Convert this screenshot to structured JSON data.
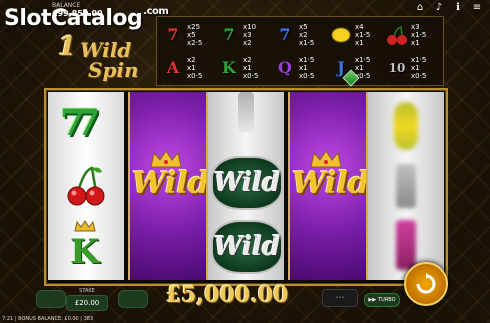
{
  "watermark": {
    "slot": "Slot",
    "catalog": "Catalog",
    "com": ".com"
  },
  "balance": {
    "label": "BALANCE",
    "value": "£99,850.00"
  },
  "logo": {
    "one": "1",
    "wild": "Wild",
    "spin": "Spin"
  },
  "paytable": [
    {
      "symbol": "seven",
      "glyph": "7",
      "color": "#e03030",
      "pays": [
        "x25",
        "x5",
        "x2·5"
      ]
    },
    {
      "symbol": "green-seven",
      "glyph": "7",
      "color": "#2ea33a",
      "pays": [
        "x10",
        "x3",
        "x2"
      ]
    },
    {
      "symbol": "blue-seven",
      "glyph": "7",
      "color": "#3a78e8",
      "pays": [
        "x5",
        "x2",
        "x1·5"
      ]
    },
    {
      "symbol": "lemon",
      "glyph": "",
      "color": "#f4d020",
      "pays": [
        "x4",
        "x1·5",
        "x1"
      ]
    },
    {
      "symbol": "cherries",
      "glyph": "",
      "color": "#d02020",
      "pays": [
        "x3",
        "x1·5",
        "x1"
      ]
    },
    {
      "symbol": "A",
      "glyph": "A",
      "color": "#e03030",
      "pays": [
        "x2",
        "x1",
        "x0·5"
      ]
    },
    {
      "symbol": "K",
      "glyph": "K",
      "color": "#2ea33a",
      "pays": [
        "x2",
        "x1",
        "x0·5"
      ]
    },
    {
      "symbol": "Q",
      "glyph": "Q",
      "color": "#9a40d8",
      "pays": [
        "x1·5",
        "x1",
        "x0·5"
      ]
    },
    {
      "symbol": "J",
      "glyph": "J",
      "color": "#3a78e8",
      "pays": [
        "x1·5",
        "x1",
        "x0·5"
      ]
    },
    {
      "symbol": "10",
      "glyph": "10",
      "color": "#c0c0c0",
      "pays": [
        "x1·5",
        "x1",
        "x0·5"
      ]
    }
  ],
  "reels": {
    "wild_label": "Wild",
    "wild_label_2": "Wild",
    "wild_green_1": "Wild",
    "wild_green_2": "Wild",
    "seven_glyph": "77",
    "k_glyph": "K"
  },
  "win": {
    "amount": "£5,000.00"
  },
  "stake": {
    "label": "STAKE",
    "value": "£20.00"
  },
  "turbo": {
    "label": "TURBO"
  },
  "footer": {
    "time": "7:21",
    "bonus": "BONUS BALANCE: £0.00",
    "id": "383"
  },
  "colors": {
    "gold": "#f0c85a",
    "purple": "#7a1ea8",
    "green": "#2ea33a",
    "spin": "#f0a800"
  }
}
